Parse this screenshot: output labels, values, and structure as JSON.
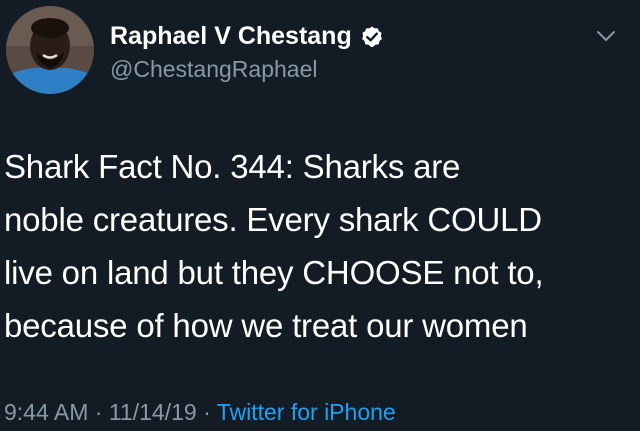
{
  "tweet": {
    "author": {
      "display_name": "Raphael V Chestang",
      "handle": "@ChestangRaphael",
      "verified": true,
      "avatar_icon": "profile-photo"
    },
    "menu_icon": "chevron-down-icon",
    "text": "Shark Fact No. 344: Sharks are\nnoble creatures. Every shark COULD\nlive on land but they CHOOSE not to,\nbecause of how we treat our women",
    "time": "9:44 AM",
    "separator": "·",
    "date": "11/14/19",
    "source": "Twitter for iPhone"
  },
  "colors": {
    "background": "#131b24",
    "secondary_text": "#8899a6",
    "link": "#1da1f2",
    "verified_badge": "#ffffff"
  }
}
